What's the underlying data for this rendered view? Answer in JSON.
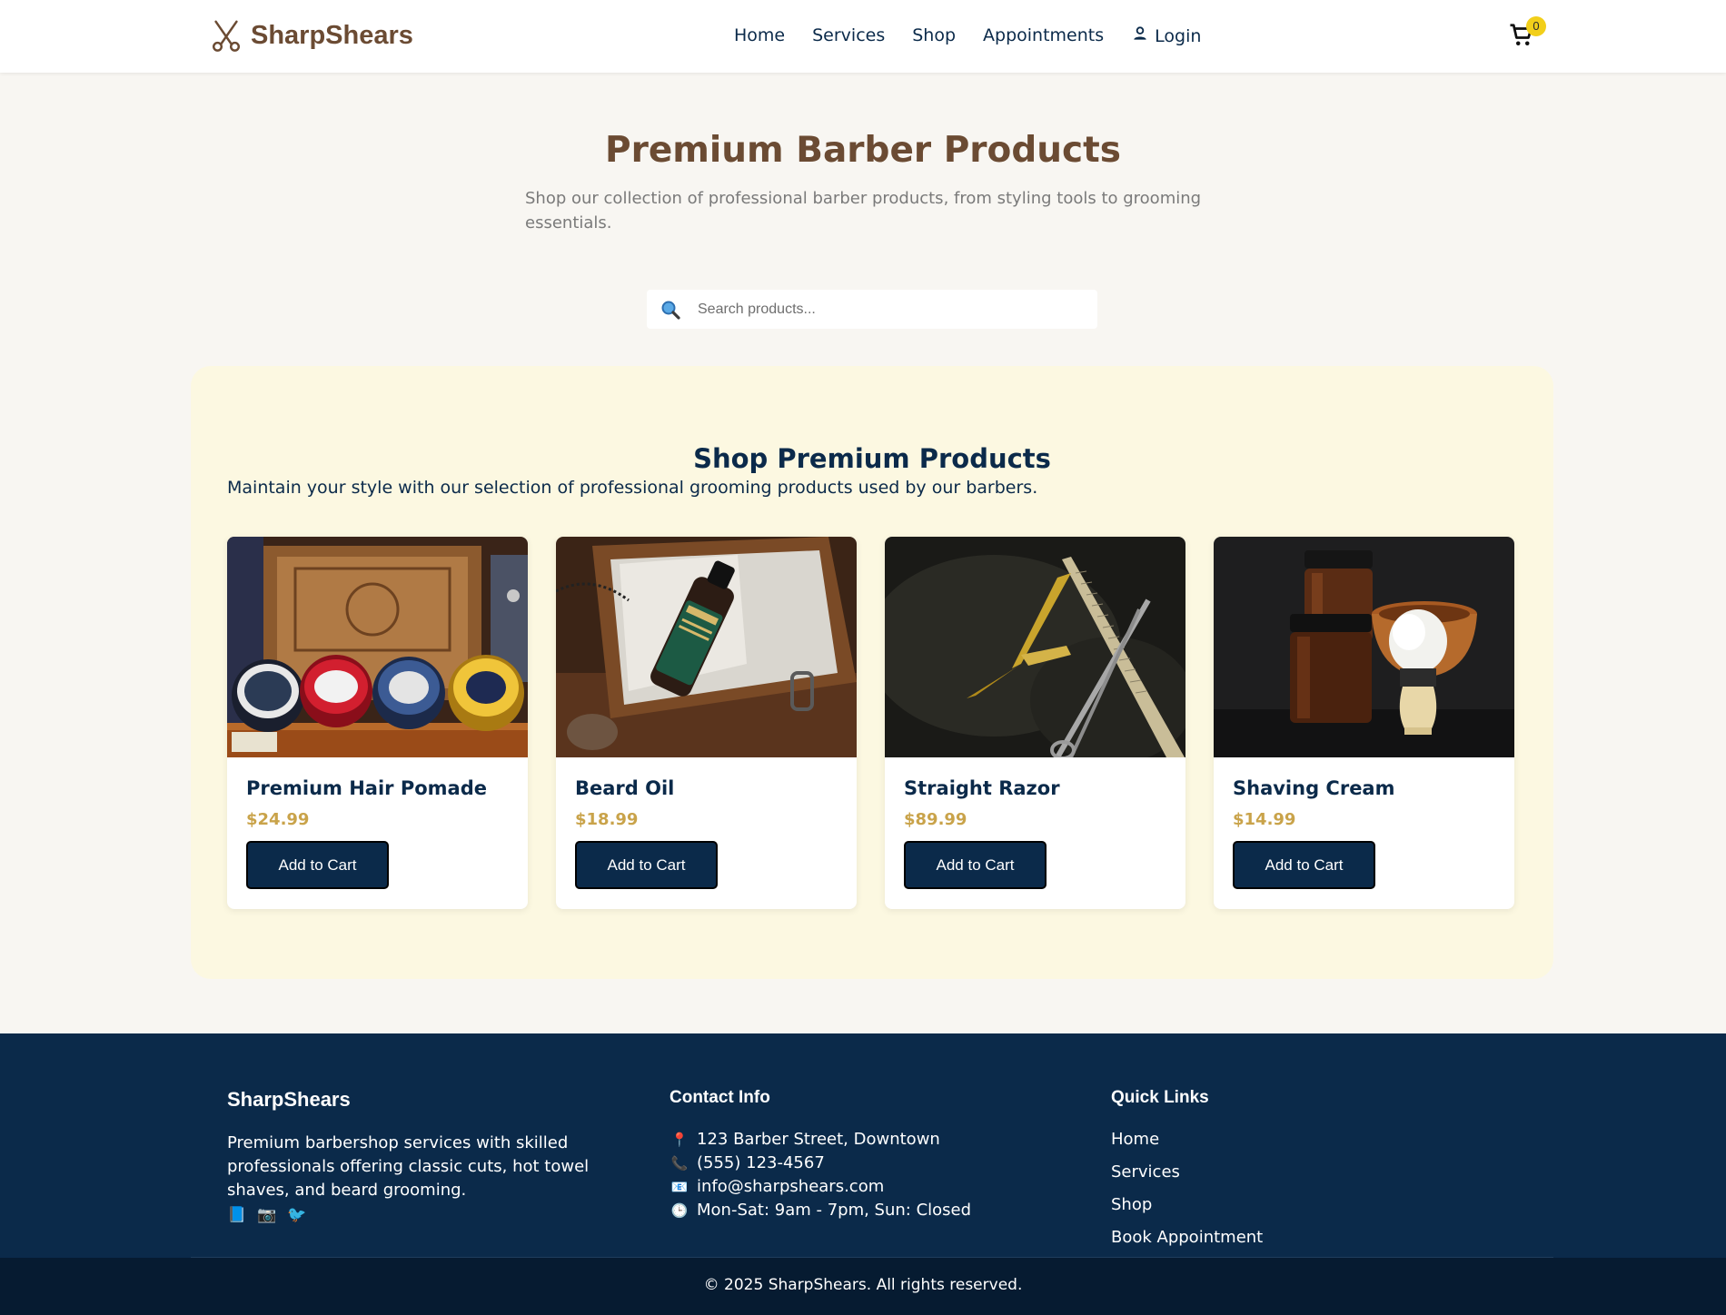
{
  "brand": {
    "name": "SharpShears"
  },
  "nav": {
    "items": [
      {
        "label": "Home"
      },
      {
        "label": "Services"
      },
      {
        "label": "Shop"
      },
      {
        "label": "Appointments"
      }
    ],
    "login_label": "Login",
    "cart_count": "0"
  },
  "hero": {
    "title": "Premium Barber Products",
    "subtitle": "Shop our collection of professional barber products, from styling tools to grooming essentials."
  },
  "search": {
    "placeholder": "Search products..."
  },
  "shop": {
    "title": "Shop Premium Products",
    "subtitle": "Maintain your style with our selection of professional grooming products used by our barbers.",
    "products": [
      {
        "name": "Premium Hair Pomade",
        "price": "$24.99",
        "button": "Add to Cart",
        "image_icon": "pomade-tins-image"
      },
      {
        "name": "Beard Oil",
        "price": "$18.99",
        "button": "Add to Cart",
        "image_icon": "beard-oil-bottle-image"
      },
      {
        "name": "Straight Razor",
        "price": "$89.99",
        "button": "Add to Cart",
        "image_icon": "straight-razor-image"
      },
      {
        "name": "Shaving Cream",
        "price": "$14.99",
        "button": "Add to Cart",
        "image_icon": "shaving-cream-jars-image"
      }
    ]
  },
  "footer": {
    "brand": {
      "title": "SharpShears",
      "description": "Premium barbershop services with skilled professionals offering classic cuts, hot towel shaves, and beard grooming.",
      "socials": [
        "📘",
        "📷",
        "🐦"
      ]
    },
    "contact": {
      "title": "Contact Info",
      "items": [
        {
          "icon": "📍",
          "text": "123 Barber Street, Downtown"
        },
        {
          "icon": "📞",
          "text": "(555) 123-4567"
        },
        {
          "icon": "📧",
          "text": "info@sharpshears.com"
        },
        {
          "icon": "🕒",
          "text": "Mon-Sat: 9am - 7pm, Sun: Closed"
        }
      ]
    },
    "links": {
      "title": "Quick Links",
      "items": [
        {
          "label": "Home"
        },
        {
          "label": "Services"
        },
        {
          "label": "Shop"
        },
        {
          "label": "Book Appointment"
        }
      ]
    },
    "copyright": "© 2025 SharpShears. All rights reserved."
  },
  "colors": {
    "brand_brown": "#6b4b33",
    "navy": "#0b2a4a",
    "gold_price": "#c9a34a",
    "panel_cream": "#fcf8e1",
    "badge_yellow": "#f2cf1a"
  }
}
